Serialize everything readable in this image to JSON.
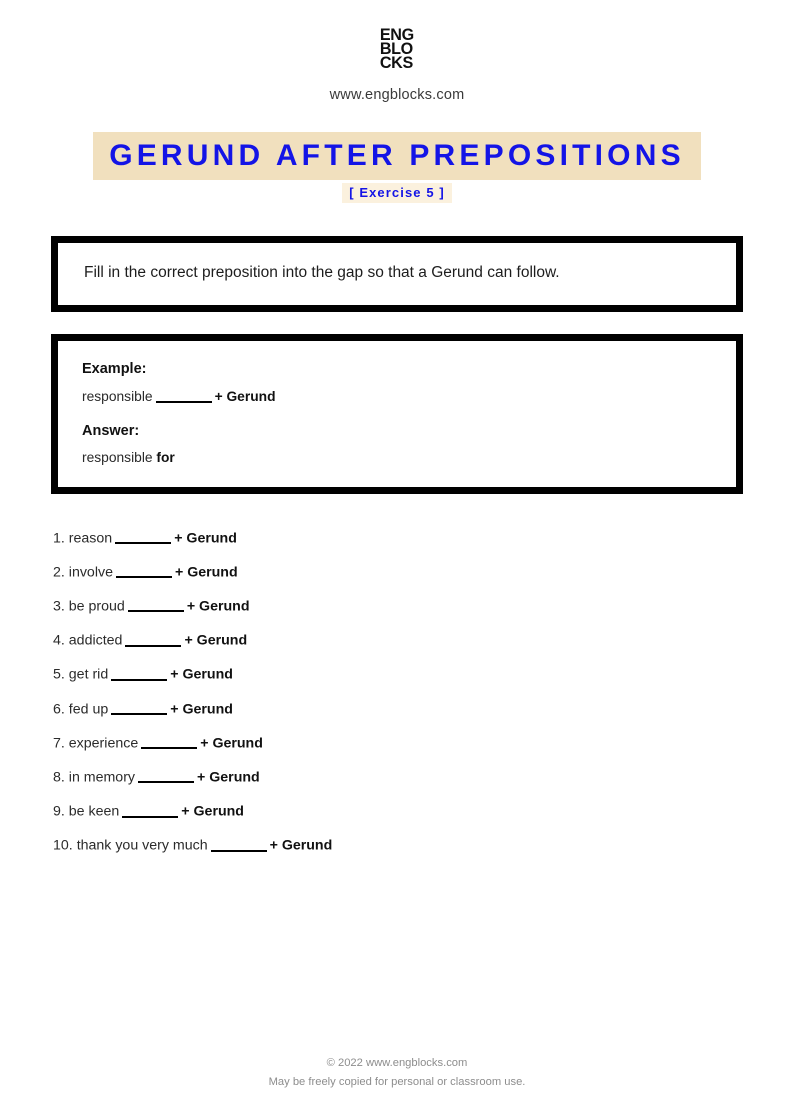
{
  "header": {
    "logo_lines": [
      "ENG",
      "BLO",
      "CKS"
    ],
    "site_url": "www.engblocks.com"
  },
  "title": {
    "main": "GERUND AFTER PREPOSITIONS",
    "subtitle": "[ Exercise 5 ]",
    "band_color": "#f1e0be",
    "subtitle_band_color": "#fbf1de",
    "text_color": "#1414e6"
  },
  "instruction": {
    "text": "Fill in the correct preposition into the gap so that a Gerund can follow."
  },
  "example": {
    "example_label": "Example:",
    "example_prompt_prefix": "responsible",
    "example_prompt_suffix": "+ Gerund",
    "answer_label": "Answer:",
    "answer_prefix": "responsible",
    "answer_word": "for"
  },
  "exercises": {
    "suffix": "+ Gerund",
    "items": [
      {
        "number": "1.",
        "prompt": "reason"
      },
      {
        "number": "2.",
        "prompt": "involve"
      },
      {
        "number": "3.",
        "prompt": "be proud"
      },
      {
        "number": "4.",
        "prompt": "addicted"
      },
      {
        "number": "5.",
        "prompt": "get rid"
      },
      {
        "number": "6.",
        "prompt": "fed up"
      },
      {
        "number": "7.",
        "prompt": "experience"
      },
      {
        "number": "8.",
        "prompt": "in memory"
      },
      {
        "number": "9.",
        "prompt": "be keen"
      },
      {
        "number": "10.",
        "prompt": "thank you very much"
      }
    ]
  },
  "footer": {
    "copyright": "© 2022 www.engblocks.com",
    "notice": "May be freely copied for personal or classroom use."
  }
}
